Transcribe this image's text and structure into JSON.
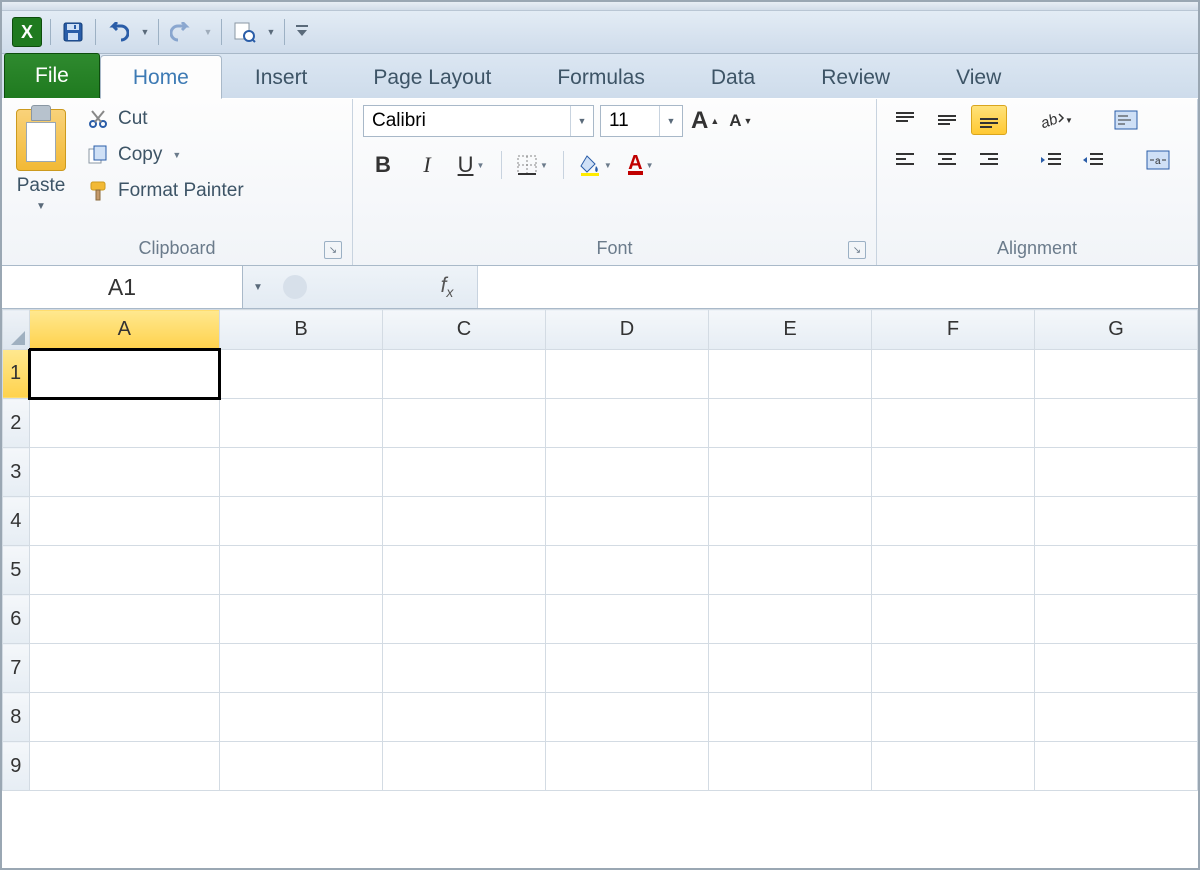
{
  "qat": {
    "icons": [
      "excel-logo",
      "save-icon",
      "undo-icon",
      "redo-icon",
      "print-preview-icon",
      "customize-qat-icon"
    ]
  },
  "tabs": {
    "file": "File",
    "items": [
      "Home",
      "Insert",
      "Page Layout",
      "Formulas",
      "Data",
      "Review",
      "View"
    ],
    "active": "Home"
  },
  "ribbon": {
    "clipboard": {
      "label": "Clipboard",
      "paste": "Paste",
      "cut": "Cut",
      "copy": "Copy",
      "format_painter": "Format Painter"
    },
    "font": {
      "label": "Font",
      "name": "Calibri",
      "size": "11"
    },
    "alignment": {
      "label": "Alignment"
    }
  },
  "namebox": "A1",
  "formula": "",
  "columns": [
    "A",
    "B",
    "C",
    "D",
    "E",
    "F",
    "G"
  ],
  "rows": [
    "1",
    "2",
    "3",
    "4",
    "5",
    "6",
    "7",
    "8",
    "9"
  ],
  "selected_col": "A",
  "selected_row": "1",
  "colors": {
    "excel_green": "#1f7a1f",
    "selection_gold": "#ffd24d"
  }
}
